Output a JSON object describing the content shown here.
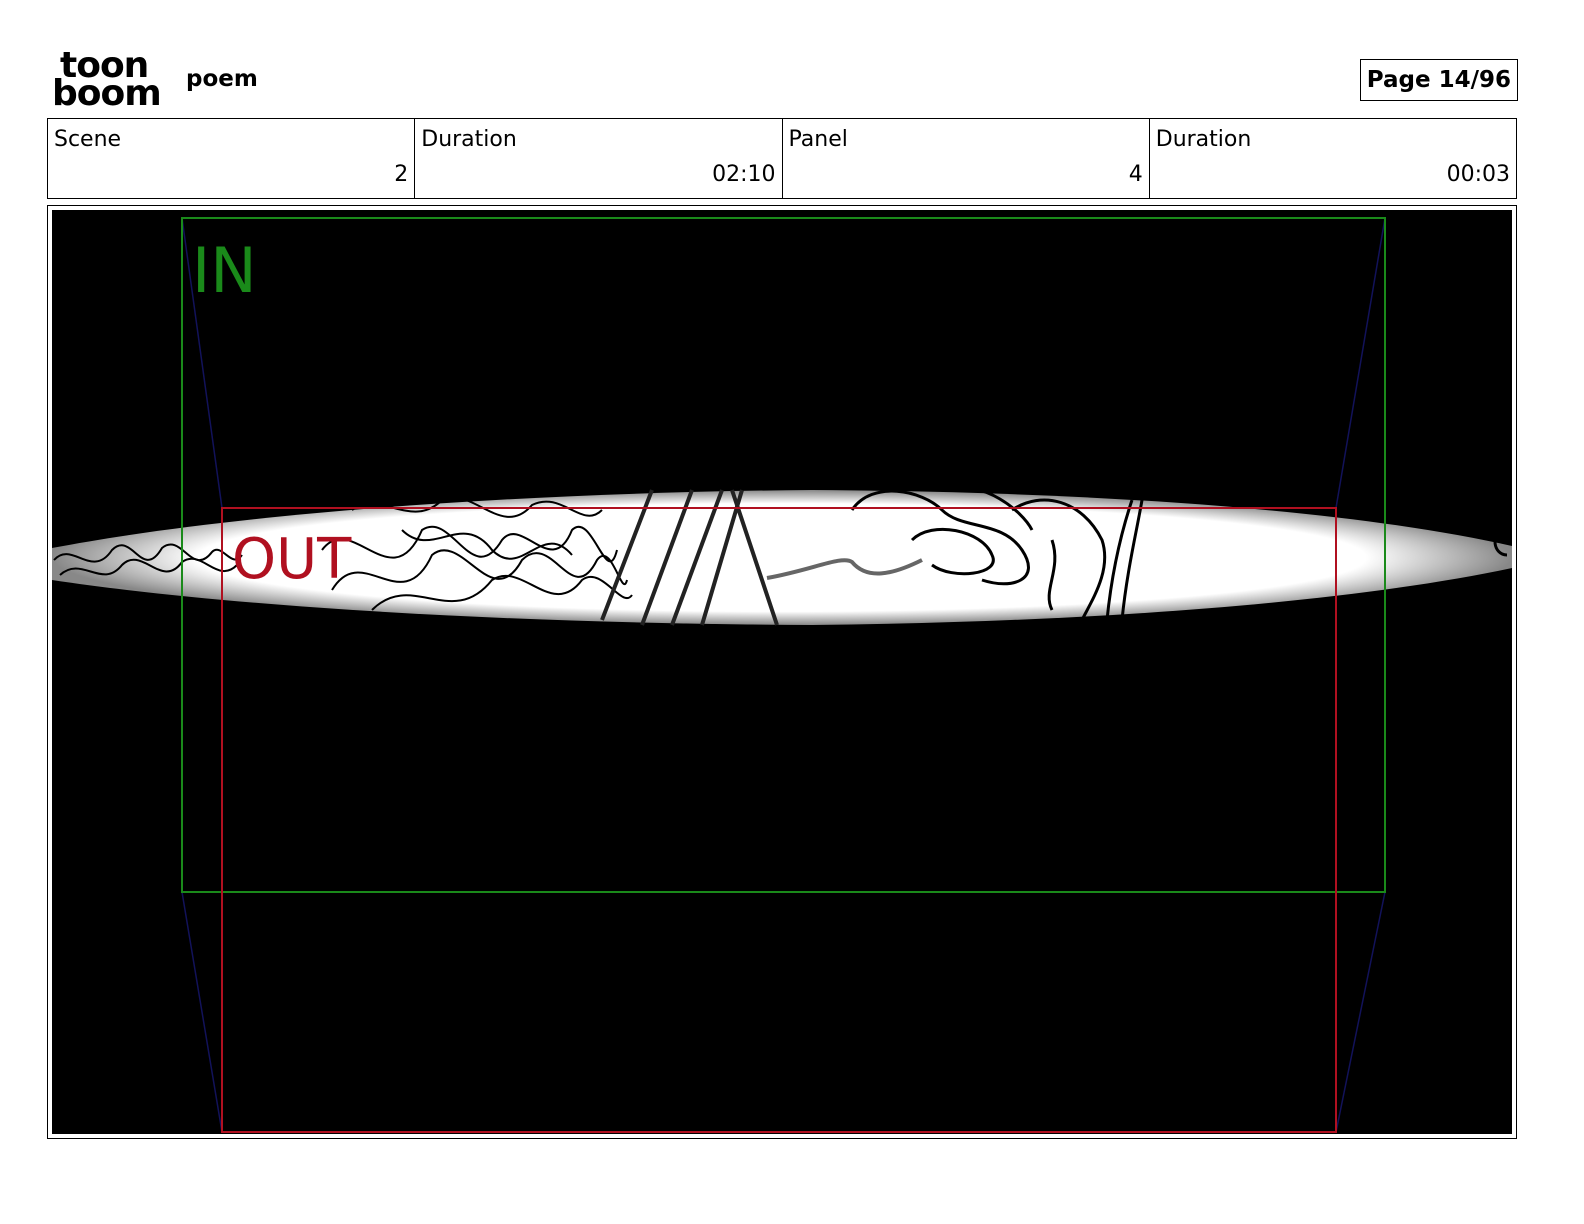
{
  "header": {
    "logo": {
      "line1": "toon",
      "line2": "boom",
      "text": "toon boom"
    },
    "project_title": "poem",
    "page_label": "Page 14/96"
  },
  "info": {
    "scene_label": "Scene",
    "scene_value": "2",
    "scene_duration_label": "Duration",
    "scene_duration_value": "02:10",
    "panel_label": "Panel",
    "panel_value": "4",
    "panel_duration_label": "Duration",
    "panel_duration_value": "00:03"
  },
  "frame": {
    "in_label": "IN",
    "out_label": "OUT",
    "colors": {
      "in": "#1a8a1a",
      "out": "#b01020",
      "background": "#000000"
    }
  }
}
